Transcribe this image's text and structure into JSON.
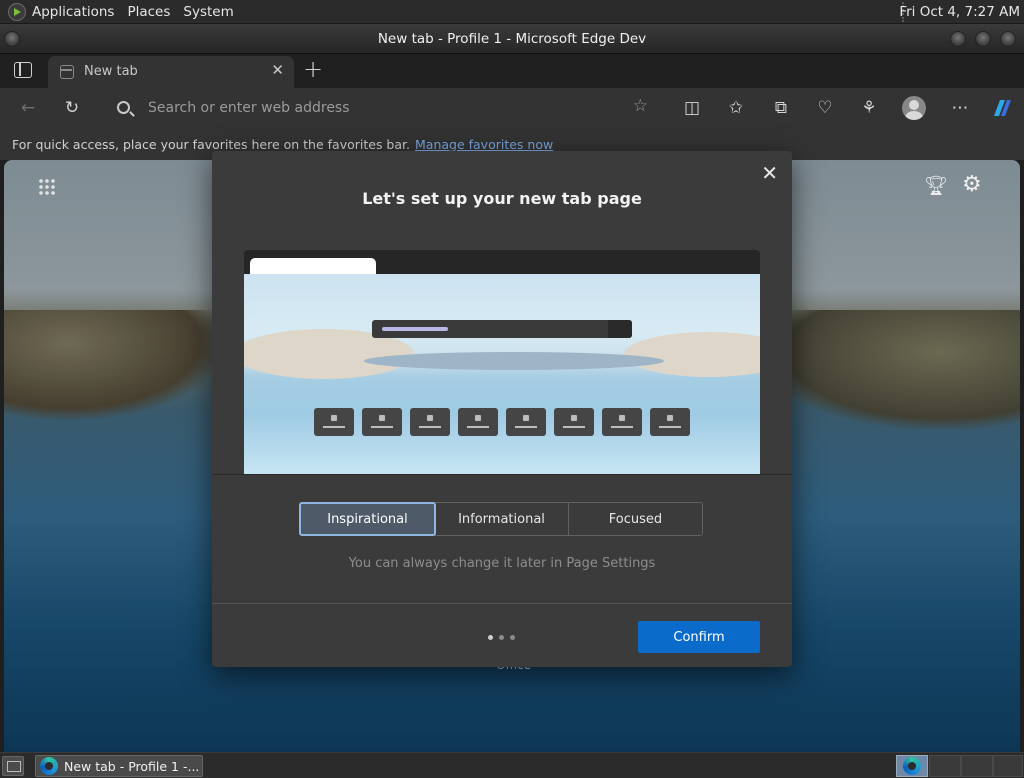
{
  "system_panel": {
    "menus": [
      "Applications",
      "Places",
      "System"
    ],
    "clock": "Fri Oct  4,  7:27 AM"
  },
  "window": {
    "title": "New tab - Profile 1 - Microsoft Edge Dev"
  },
  "tabs": [
    {
      "label": "New tab"
    }
  ],
  "toolbar": {
    "address_placeholder": "Search or enter web address"
  },
  "favorites_bar": {
    "message": "For quick access, place your favorites here on the favorites bar.",
    "link": "Manage favorites now"
  },
  "new_tab_page": {
    "footer_label": "Office"
  },
  "dialog": {
    "title": "Let's set up your new tab page",
    "options": [
      "Inspirational",
      "Informational",
      "Focused"
    ],
    "selected": "Inspirational",
    "hint": "You can always change it later in Page Settings",
    "confirm_label": "Confirm",
    "page_indicator": {
      "total": 3,
      "current": 1
    }
  },
  "taskbar": {
    "task_label": "New tab - Profile 1 -..."
  },
  "colors": {
    "accent": "#0b6bcb",
    "selected_option_border": "#8fb5e0",
    "link": "#7aa7e0"
  }
}
